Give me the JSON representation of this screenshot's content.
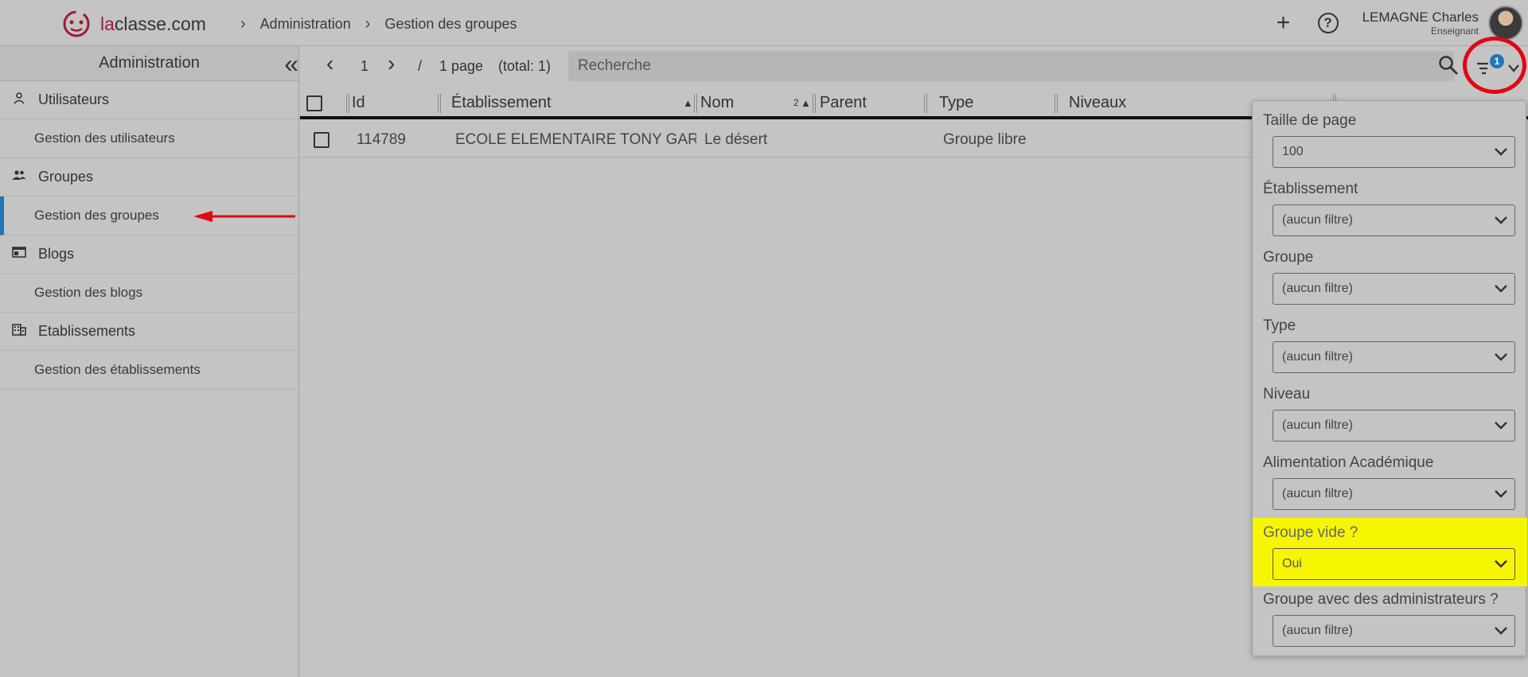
{
  "brand": {
    "prefix": "la",
    "rest": "classe.com"
  },
  "breadcrumb": [
    "Administration",
    "Gestion des groupes"
  ],
  "user": {
    "name": "LEMAGNE Charles",
    "role": "Enseignant"
  },
  "sidebar": {
    "title": "Administration",
    "sections": [
      {
        "label": "Utilisateurs",
        "icon": "user-icon",
        "item": "Gestion des utilisateurs"
      },
      {
        "label": "Groupes",
        "icon": "users-icon",
        "item": "Gestion des groupes"
      },
      {
        "label": "Blogs",
        "icon": "blog-icon",
        "item": "Gestion des blogs"
      },
      {
        "label": "Etablissements",
        "icon": "building-icon",
        "item": "Gestion des établissements"
      }
    ],
    "active_item": "Gestion des groupes"
  },
  "toolbar": {
    "page": "1",
    "separator": "/",
    "pages_text": "1 page",
    "total_text": "(total: 1)",
    "search_placeholder": "Recherche",
    "filter_count": "1"
  },
  "table": {
    "columns": [
      "Id",
      "Établissement",
      "Nom",
      "Parent",
      "Type",
      "Niveaux"
    ],
    "sort_index_nom": "2",
    "rows": [
      {
        "id": "114789",
        "etablissement": "ECOLE ELEMENTAIRE TONY GAR",
        "nom": "Le désert",
        "parent": "",
        "type": "Groupe libre",
        "niveaux": ""
      }
    ]
  },
  "filters": [
    {
      "label": "Taille de page",
      "value": "100"
    },
    {
      "label": "Établissement",
      "value": "(aucun filtre)"
    },
    {
      "label": "Groupe",
      "value": "(aucun filtre)"
    },
    {
      "label": "Type",
      "value": "(aucun filtre)"
    },
    {
      "label": "Niveau",
      "value": "(aucun filtre)"
    },
    {
      "label": "Alimentation Académique",
      "value": "(aucun filtre)"
    },
    {
      "label": "Groupe vide ?",
      "value": "Oui"
    },
    {
      "label": "Groupe avec des administrateurs ?",
      "value": "(aucun filtre)"
    }
  ],
  "colors": {
    "accent": "#1f76b8",
    "brand": "#a01a3a",
    "highlight": "#f6f600",
    "annotation": "#e30613"
  }
}
